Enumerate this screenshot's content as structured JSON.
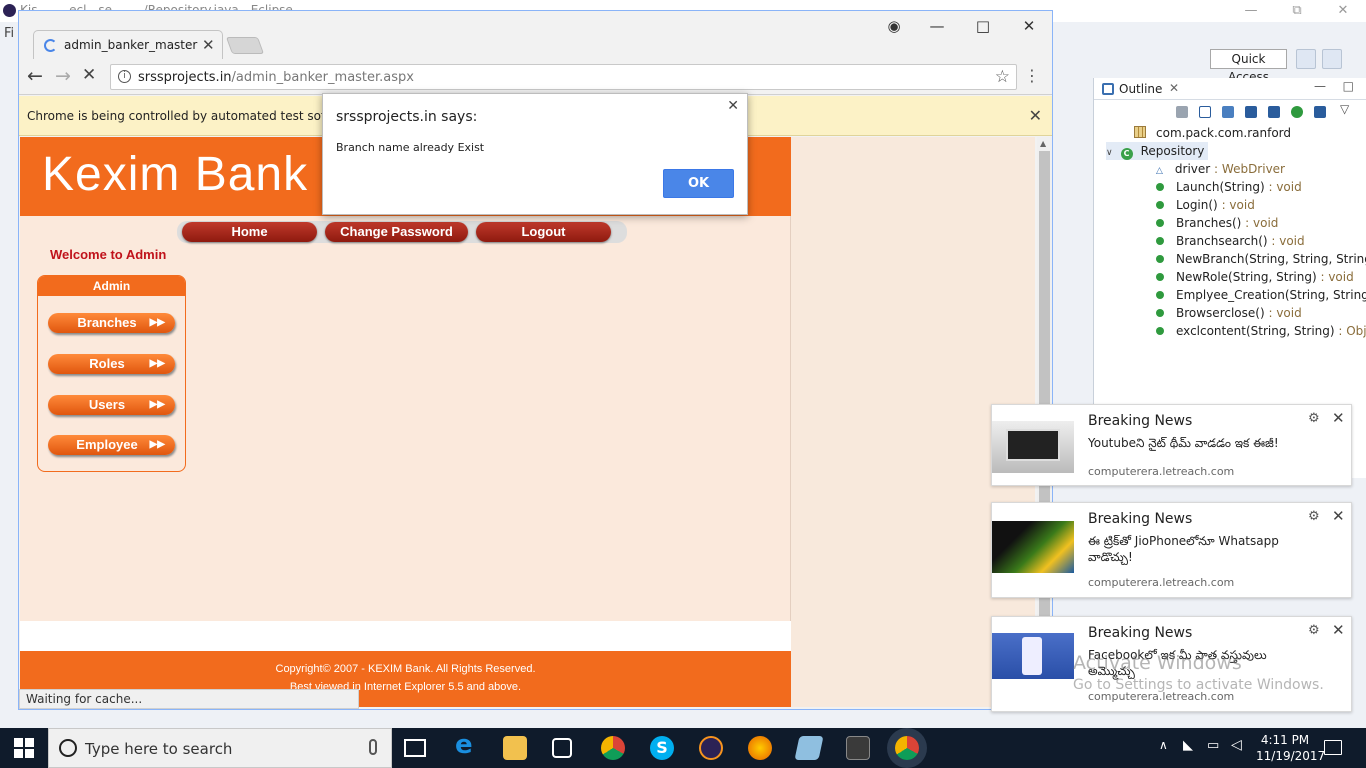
{
  "eclipse": {
    "title_text": "Kis… — ecl…se — …/Repository.java - Eclipse",
    "file_menu": "Fi",
    "quick_access": "Quick Access",
    "outline": {
      "tab_label": "Outline",
      "package": "com.pack.com.ranford",
      "class": "Repository",
      "members": [
        {
          "name": "driver",
          "type": " : WebDriver",
          "kind": "field"
        },
        {
          "name": "Launch(String)",
          "type": " : void",
          "kind": "method"
        },
        {
          "name": "Login()",
          "type": " : void",
          "kind": "method"
        },
        {
          "name": "Branches()",
          "type": " : void",
          "kind": "method"
        },
        {
          "name": "Branchsearch()",
          "type": " : void",
          "kind": "method"
        },
        {
          "name": "NewBranch(String, String, String, St",
          "type": "",
          "kind": "method"
        },
        {
          "name": "NewRole(String, String)",
          "type": " : void",
          "kind": "method"
        },
        {
          "name": "Emplyee_Creation(String, String, St",
          "type": "",
          "kind": "method"
        },
        {
          "name": "Browserclose()",
          "type": " : void",
          "kind": "method"
        },
        {
          "name": "exclcontent(String, String)",
          "type": " : Object[",
          "kind": "method"
        }
      ]
    }
  },
  "chrome": {
    "tab_title": "admin_banker_master",
    "url_host": "srssprojects.in",
    "url_path": "/admin_banker_master.aspx",
    "infobar_message": "Chrome is being controlled by automated test software.",
    "status_text": "Waiting for cache..."
  },
  "page": {
    "bank_name": "Kexim Bank",
    "nav": [
      "Home",
      "Change Password",
      "Logout"
    ],
    "welcome": "Welcome to Admin",
    "admin_header": "Admin",
    "admin_buttons": [
      "Branches",
      "Roles",
      "Users",
      "Employee"
    ],
    "footer_line1": "Copyright© 2007 - KEXIM Bank. All Rights Reserved.",
    "footer_line2": "Best viewed in Internet Explorer 5.5 and above."
  },
  "alert": {
    "origin": "srssprojects.in says:",
    "message": "Branch name already Exist",
    "ok_label": "OK"
  },
  "notifications": [
    {
      "title": "Breaking News",
      "body": "Youtubeని నైట్ థీమ్ వాడడం ఇక ఈజీ!",
      "source": "computerera.letreach.com"
    },
    {
      "title": "Breaking News",
      "body": "ఈ ట్రిక్‌తో JioPhoneలోనూ Whatsapp వాడొచ్చు!",
      "source": "computerera.letreach.com"
    },
    {
      "title": "Breaking News",
      "body": "Facebookలో ఇక మీ పాత వస్తువులు అమ్మొచ్చు",
      "source": "computerera.letreach.com"
    }
  ],
  "watermark": {
    "line1": "Activate Windows",
    "line2": "Go to Settings to activate Windows."
  },
  "taskbar": {
    "search_placeholder": "Type here to search",
    "time": "4:11 PM",
    "date": "11/19/2017"
  },
  "colors": {
    "bank_orange": "#f26b1d",
    "nav_red": "#c0392b",
    "chrome_blue": "#4a86e8",
    "infobar_yellow": "#fcf2c6",
    "taskbar": "#0f1b2b"
  }
}
